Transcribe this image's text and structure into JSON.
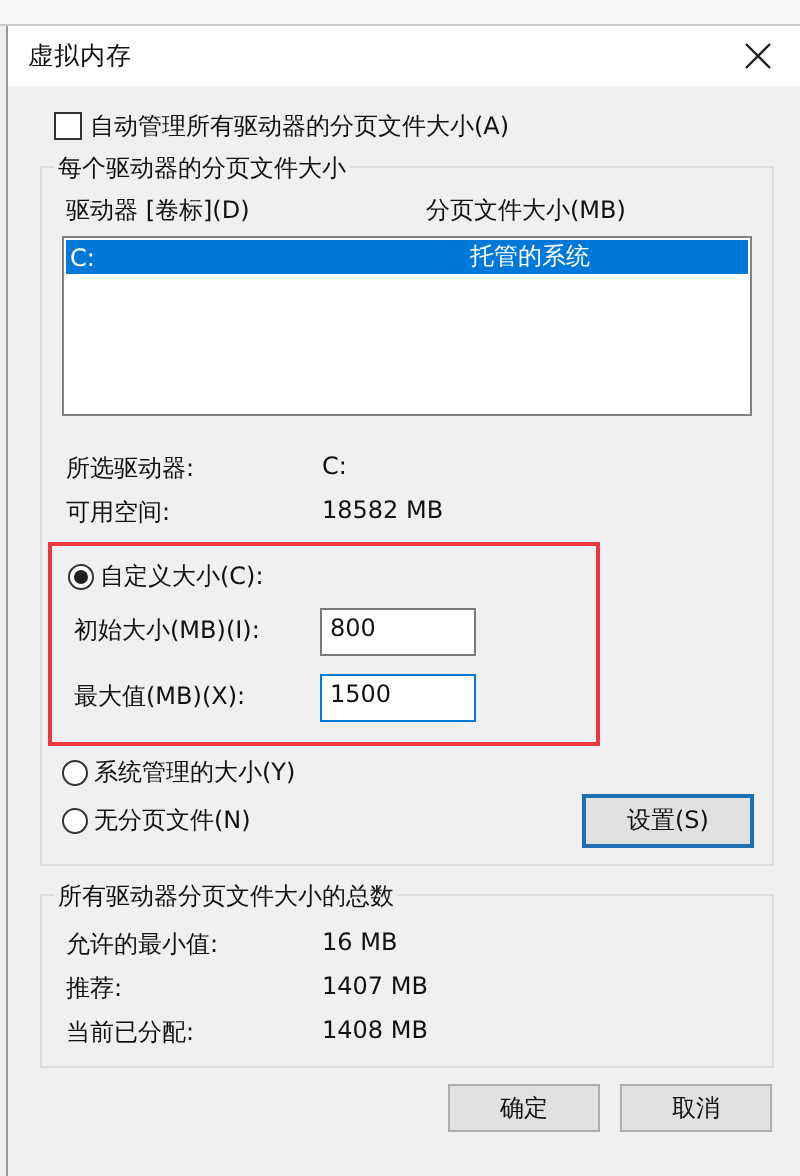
{
  "window": {
    "title": "虚拟内存"
  },
  "auto_manage": {
    "label": "自动管理所有驱动器的分页文件大小(A)",
    "checked": false
  },
  "drives_group": {
    "title": "每个驱动器的分页文件大小",
    "columns": [
      "驱动器 [卷标](D)",
      "分页文件大小(MB)"
    ],
    "rows": [
      {
        "drive": "C:",
        "size": "托管的系统",
        "selected": true
      }
    ],
    "info": [
      {
        "label": "所选驱动器:",
        "value": "C:"
      },
      {
        "label": "可用空间:",
        "value": "18582 MB"
      }
    ],
    "options": [
      {
        "label": "自定义大小(C):",
        "selected": true,
        "highlighted": true
      },
      {
        "label": "系统管理的大小(Y)",
        "selected": false,
        "highlighted": false
      },
      {
        "label": "无分页文件(N)",
        "selected": false,
        "highlighted": false
      }
    ],
    "fields": [
      {
        "label": "初始大小(MB)(I):",
        "value": "800",
        "focused": false
      },
      {
        "label": "最大值(MB)(X):",
        "value": "1500",
        "focused": true
      }
    ],
    "set_button": "设置(S)"
  },
  "totals_group": {
    "title": "所有驱动器分页文件大小的总数",
    "rows": [
      {
        "label": "允许的最小值:",
        "value": "16 MB"
      },
      {
        "label": "推荐:",
        "value": "1407 MB"
      },
      {
        "label": "当前已分配:",
        "value": "1408 MB"
      }
    ]
  },
  "buttons": [
    "确定",
    "取消"
  ]
}
